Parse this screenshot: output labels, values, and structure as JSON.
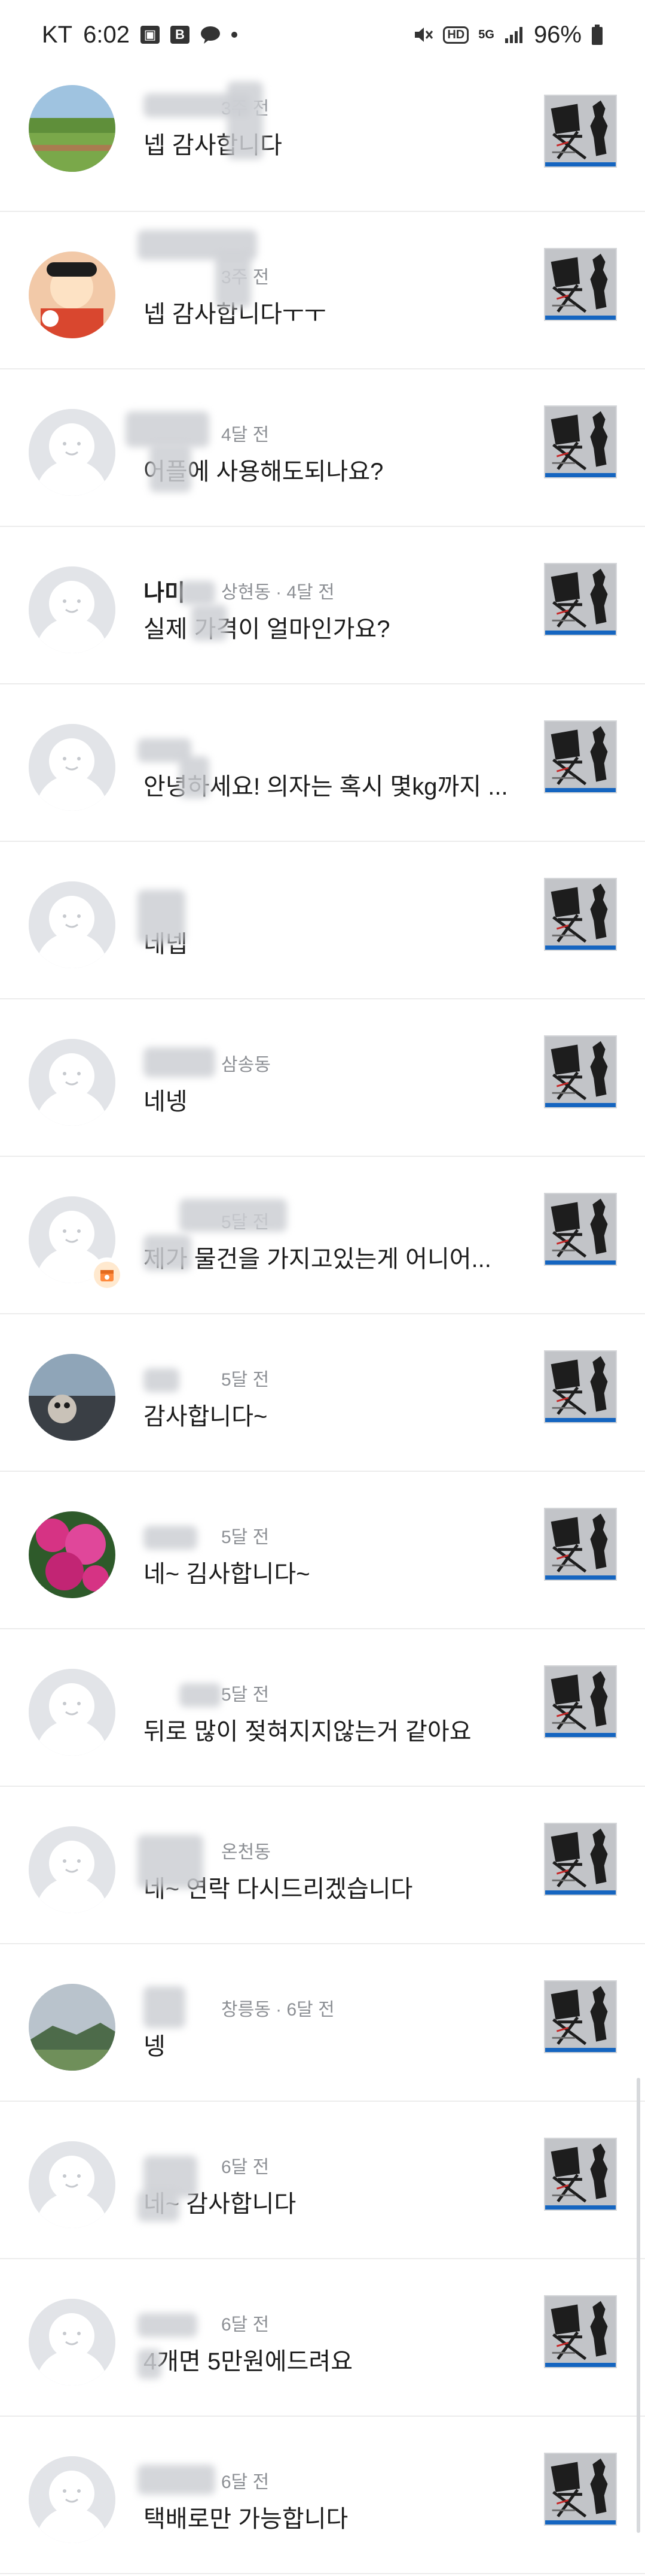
{
  "status_bar": {
    "carrier": "KT",
    "time": "6:02",
    "battery": "96%",
    "network": "5G",
    "hd_label": "HD"
  },
  "chats": [
    {
      "nickname": "",
      "location": "",
      "time_ago": "3주 전",
      "message": "넵 감사합니다",
      "avatar": "photo-green"
    },
    {
      "nickname": "",
      "location": "",
      "time_ago": "3주 전",
      "message": "넵 감사합니다ㅜㅜ",
      "avatar": "photo-cartoon"
    },
    {
      "nickname": "",
      "location": "",
      "time_ago": "4달 전",
      "message": "어플에 사용해도되나요?",
      "avatar": "default"
    },
    {
      "nickname": "나미",
      "location": "상현동",
      "time_ago": "4달 전",
      "message": "실제 가격이 얼마인가요?",
      "avatar": "default"
    },
    {
      "nickname": "",
      "location": "",
      "time_ago": "",
      "message": "안녕하세요! 의자는 혹시 몇kg까지 ...",
      "avatar": "default"
    },
    {
      "nickname": "",
      "location": "",
      "time_ago": "",
      "message": "네넵",
      "avatar": "default"
    },
    {
      "nickname": "",
      "location": "삼송동",
      "time_ago": "",
      "message": "네넹",
      "avatar": "default"
    },
    {
      "nickname": "",
      "location": "",
      "time_ago": "5달 전",
      "message": "제가 물건을 가지고있는게 어니어...",
      "avatar": "default",
      "badge": true
    },
    {
      "nickname": "",
      "location": "",
      "time_ago": "5달 전",
      "message": "감사합니다~",
      "avatar": "photo-car"
    },
    {
      "nickname": "",
      "location": "",
      "time_ago": "5달 전",
      "message": "네~ 김사합니다~",
      "avatar": "photo-flower"
    },
    {
      "nickname": "",
      "location": "",
      "time_ago": "5달 전",
      "message": "뒤로 많이 젖혀지지않는거 같아요",
      "avatar": "default"
    },
    {
      "nickname": "",
      "location": "온천동",
      "time_ago": "",
      "message": "네~ 연락 다시드리겠습니다",
      "avatar": "default"
    },
    {
      "nickname": "",
      "location": "창릉동",
      "time_ago": "6달 전",
      "message": "넹",
      "avatar": "photo-mountain"
    },
    {
      "nickname": "",
      "location": "",
      "time_ago": "6달 전",
      "message": "네~ 감사합니다",
      "avatar": "default"
    },
    {
      "nickname": "",
      "location": "",
      "time_ago": "6달 전",
      "message": "4개면 5만원에드려요",
      "avatar": "default"
    },
    {
      "nickname": "",
      "location": "",
      "time_ago": "6달 전",
      "message": "택배로만 가능합니다",
      "avatar": "default"
    }
  ],
  "colors": {
    "divider": "#ececec",
    "meta_text": "#8c8f94",
    "thumb_accent": "#1565c0"
  }
}
